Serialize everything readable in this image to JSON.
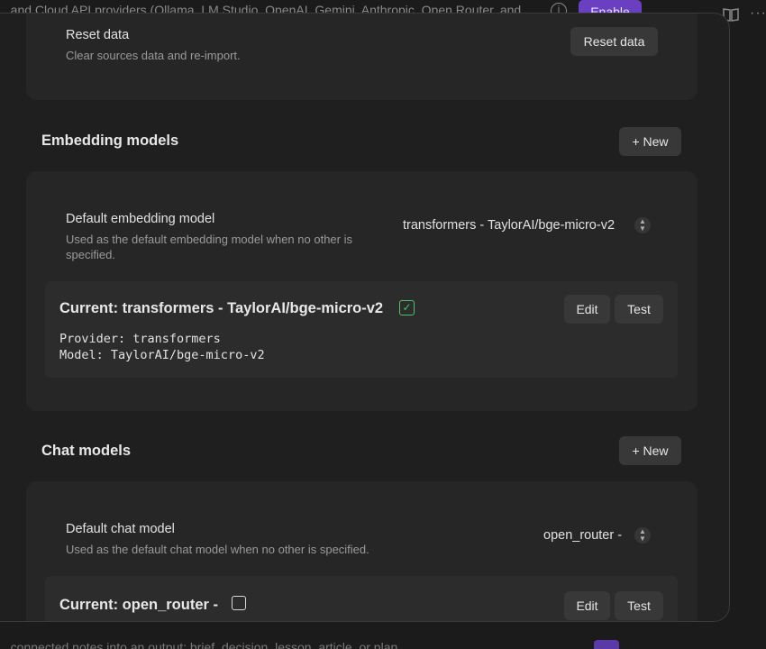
{
  "background": {
    "top_text": "...and Cloud API providers (Ollama, LM Studio, OpenAI, Gemini, Anthropic, Open Router, and",
    "enable_label": "Enable",
    "bottom_text": "...connected notes into an output: brief, decision, lesson, article, or plan"
  },
  "reset": {
    "name": "Reset data",
    "desc": "Clear sources data and re-import.",
    "button_label": "Reset data"
  },
  "embedding": {
    "section_title": "Embedding models",
    "new_label": "+ New",
    "default_name": "Default embedding model",
    "default_desc": "Used as the default embedding model when no other is specified.",
    "selected": "transformers - TaylorAI/bge-micro-v2",
    "current_title": "Current: transformers - TaylorAI/bge-micro-v2",
    "provider_line": "Provider: transformers",
    "model_line": "Model: TaylorAI/bge-micro-v2",
    "edit_label": "Edit",
    "test_label": "Test"
  },
  "chat": {
    "section_title": "Chat models",
    "new_label": "+ New",
    "default_name": "Default chat model",
    "default_desc": "Used as the default chat model when no other is specified.",
    "selected": "open_router -",
    "current_title": "Current: open_router -",
    "edit_label": "Edit",
    "test_label": "Test"
  },
  "colors": {
    "accent_purple": "#6a3fc2",
    "check_green": "#4cc26a"
  }
}
